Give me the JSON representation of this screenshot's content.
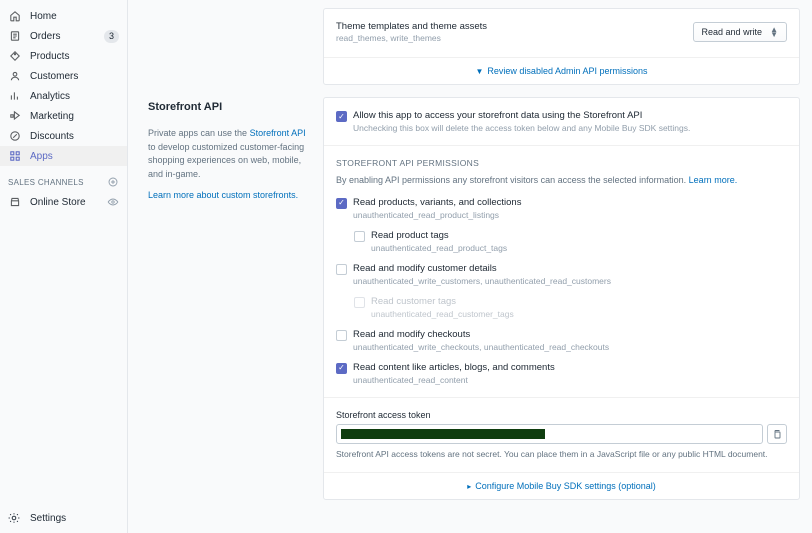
{
  "nav": {
    "items": [
      {
        "label": "Home",
        "name": "nav-home"
      },
      {
        "label": "Orders",
        "name": "nav-orders",
        "badge": "3"
      },
      {
        "label": "Products",
        "name": "nav-products"
      },
      {
        "label": "Customers",
        "name": "nav-customers"
      },
      {
        "label": "Analytics",
        "name": "nav-analytics"
      },
      {
        "label": "Marketing",
        "name": "nav-marketing"
      },
      {
        "label": "Discounts",
        "name": "nav-discounts"
      },
      {
        "label": "Apps",
        "name": "nav-apps",
        "active": true
      }
    ],
    "section_label": "SALES CHANNELS",
    "online_store": "Online Store",
    "settings": "Settings"
  },
  "desc": {
    "title": "Storefront API",
    "text_before": "Private apps can use the ",
    "link1": "Storefront API",
    "text_after": " to develop customized customer-facing shopping experiences on web, mobile, and in-game.",
    "link2": "Learn more about custom storefronts."
  },
  "card1": {
    "theme_title": "Theme templates and theme assets",
    "theme_sub": "read_themes, write_themes",
    "select_value": "Read and write",
    "footer": "Review disabled Admin API permissions"
  },
  "card2": {
    "allow_label": "Allow this app to access your storefront data using the Storefront API",
    "allow_sub": "Unchecking this box will delete the access token below and any Mobile Buy SDK settings.",
    "section_title": "STOREFRONT API PERMISSIONS",
    "section_desc": "By enabling API permissions any storefront visitors can access the selected information. ",
    "learn_more": "Learn more.",
    "perms": [
      {
        "label": "Read products, variants, and collections",
        "sub": "unauthenticated_read_product_listings",
        "checked": true,
        "child": {
          "label": "Read product tags",
          "sub": "unauthenticated_read_product_tags",
          "checked": false
        }
      },
      {
        "label": "Read and modify customer details",
        "sub": "unauthenticated_write_customers, unauthenticated_read_customers",
        "checked": false,
        "child": {
          "label": "Read customer tags",
          "sub": "unauthenticated_read_customer_tags",
          "checked": false,
          "disabled": true
        }
      },
      {
        "label": "Read and modify checkouts",
        "sub": "unauthenticated_write_checkouts, unauthenticated_read_checkouts",
        "checked": false
      },
      {
        "label": "Read content like articles, blogs, and comments",
        "sub": "unauthenticated_read_content",
        "checked": true
      }
    ],
    "token_label": "Storefront access token",
    "token_note": "Storefront API access tokens are not secret. You can place them in a JavaScript file or any public HTML document.",
    "footer": "Configure Mobile Buy SDK settings (optional)"
  }
}
